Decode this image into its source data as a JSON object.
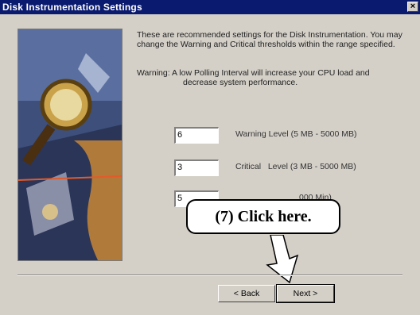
{
  "window": {
    "title": "Disk Instrumentation Settings",
    "close_glyph": "×"
  },
  "description": "These are recommended settings for the Disk Instrumentation. You may change the Warning and Critical thresholds within the range specified.",
  "warning": {
    "line1": "Warning: A low Polling Interval will increase your CPU load and",
    "line2": "decrease system performance."
  },
  "fields": [
    {
      "value": "6",
      "label": "Warning Level (5 MB - 5000 MB)"
    },
    {
      "value": "3",
      "label": "Critical   Level (3 MB - 5000 MB)"
    },
    {
      "value": "5",
      "label": "000 Min)"
    }
  ],
  "callout": "(7)  Click here.",
  "buttons": {
    "back": "< Back",
    "next": "Next >"
  },
  "colors": {
    "titlebar": "#0a1a6e",
    "face": "#d4d0c8"
  }
}
